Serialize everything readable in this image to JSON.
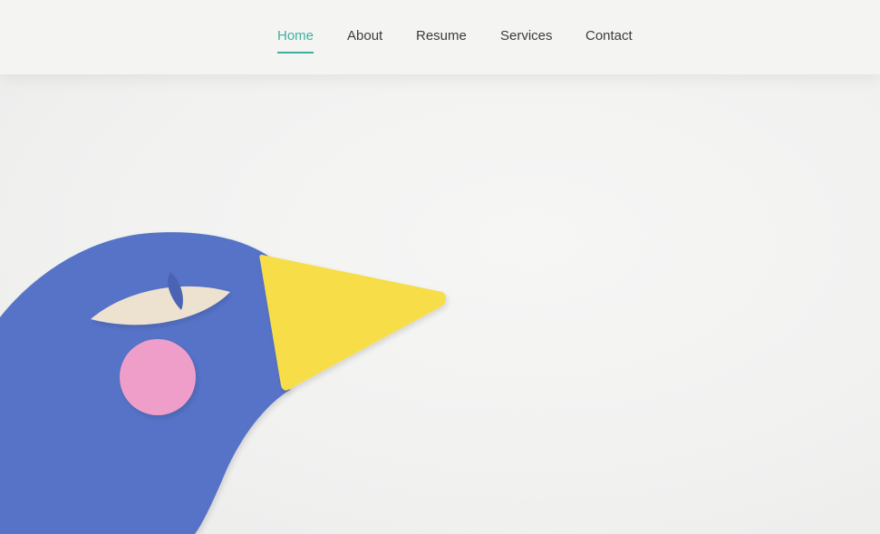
{
  "nav": {
    "items": [
      {
        "label": "Home",
        "active": true
      },
      {
        "label": "About"
      },
      {
        "label": "Resume"
      },
      {
        "label": "Services"
      },
      {
        "label": "Contact"
      }
    ]
  },
  "hero": {
    "illustration": "paper-cut-blue-bird-icon"
  },
  "colors": {
    "accent": "#3fb0a0",
    "nav_text": "#3b3b3b",
    "background": "#f3f3f2",
    "bird_body": "#5673c8",
    "beak": "#f7de4a",
    "eye": "#ece2cf",
    "cheek": "#ee9ec9"
  }
}
